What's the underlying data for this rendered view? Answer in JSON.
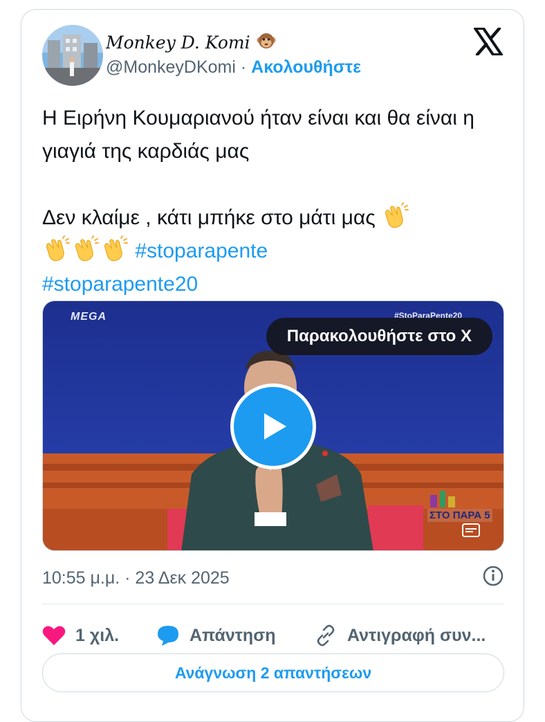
{
  "author": {
    "display_name": "Monkey D. Komi",
    "handle": "@MonkeyDKomi",
    "separator": "·",
    "follow_label": "Ακολουθήστε"
  },
  "tweet": {
    "line1": "Η Ειρήνη Κουμαριανού ήταν είναι και θα είναι η γιαγιά της καρδιάς μας",
    "line2": "Δεν κλαίμε , κάτι μπήκε στο μάτι μας",
    "hashtags": [
      "#stoparapente",
      "#stoparapente20"
    ]
  },
  "media": {
    "watch_label": "Παρακολουθήστε στο X",
    "channel_logo": "MEGA",
    "overlay_hashtag": "#StoParaPente20",
    "show_logo_text": "ΣΤΟ ΠΑΡΑ 5"
  },
  "meta": {
    "timestamp": "10:55 μ.μ. · 23 Δεκ 2025"
  },
  "actions": {
    "like_count": "1 χιλ.",
    "reply_label": "Απάντηση",
    "copy_label": "Αντιγραφή συν..."
  },
  "read_replies_label": "Ανάγνωση 2 απαντήσεων",
  "colors": {
    "accent": "#1d9bf0",
    "like": "#f91880",
    "muted": "#536471"
  }
}
